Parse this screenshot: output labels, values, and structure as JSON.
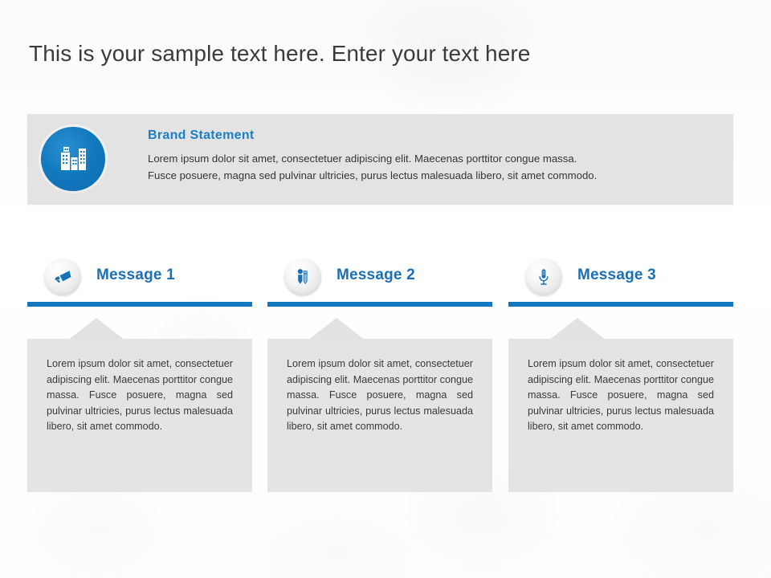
{
  "slide": {
    "title": "This is your sample text here. Enter your text here",
    "accent_color": "#1277be",
    "heading_color": "#1b7fc4",
    "panel_color": "#e3e3e3",
    "card_color": "#e4e4e4",
    "background_color": "#ffffff"
  },
  "brand_statement": {
    "icon": "city-buildings-icon",
    "heading": "Brand Statement",
    "body_line_1": "Lorem ipsum dolor sit amet, consectetuer adipiscing elit. Maecenas porttitor congue massa.",
    "body_line_2": "Fusce posuere, magna sed pulvinar ultricies, purus lectus malesuada libero, sit amet commodo."
  },
  "messages": [
    {
      "icon": "megaphone-icon",
      "title": "Message 1",
      "body": "Lorem ipsum dolor sit amet, consectetuer adipiscing elit. Maecenas porttitor congue massa. Fusce posuere, magna sed pulvinar ultricies, purus lectus malesuada libero, sit amet commodo."
    },
    {
      "icon": "pen-person-icon",
      "title": "Message 2",
      "body": "Lorem ipsum dolor sit amet, consectetuer adipiscing elit. Maecenas porttitor congue massa. Fusce posuere, magna sed pulvinar ultricies, purus lectus malesuada libero, sit amet commodo."
    },
    {
      "icon": "microphone-icon",
      "title": "Message 3",
      "body": "Lorem ipsum dolor sit amet, consectetuer adipiscing elit. Maecenas porttitor congue massa. Fusce posuere, magna sed pulvinar ultricies, purus lectus malesuada libero, sit amet commodo."
    }
  ]
}
